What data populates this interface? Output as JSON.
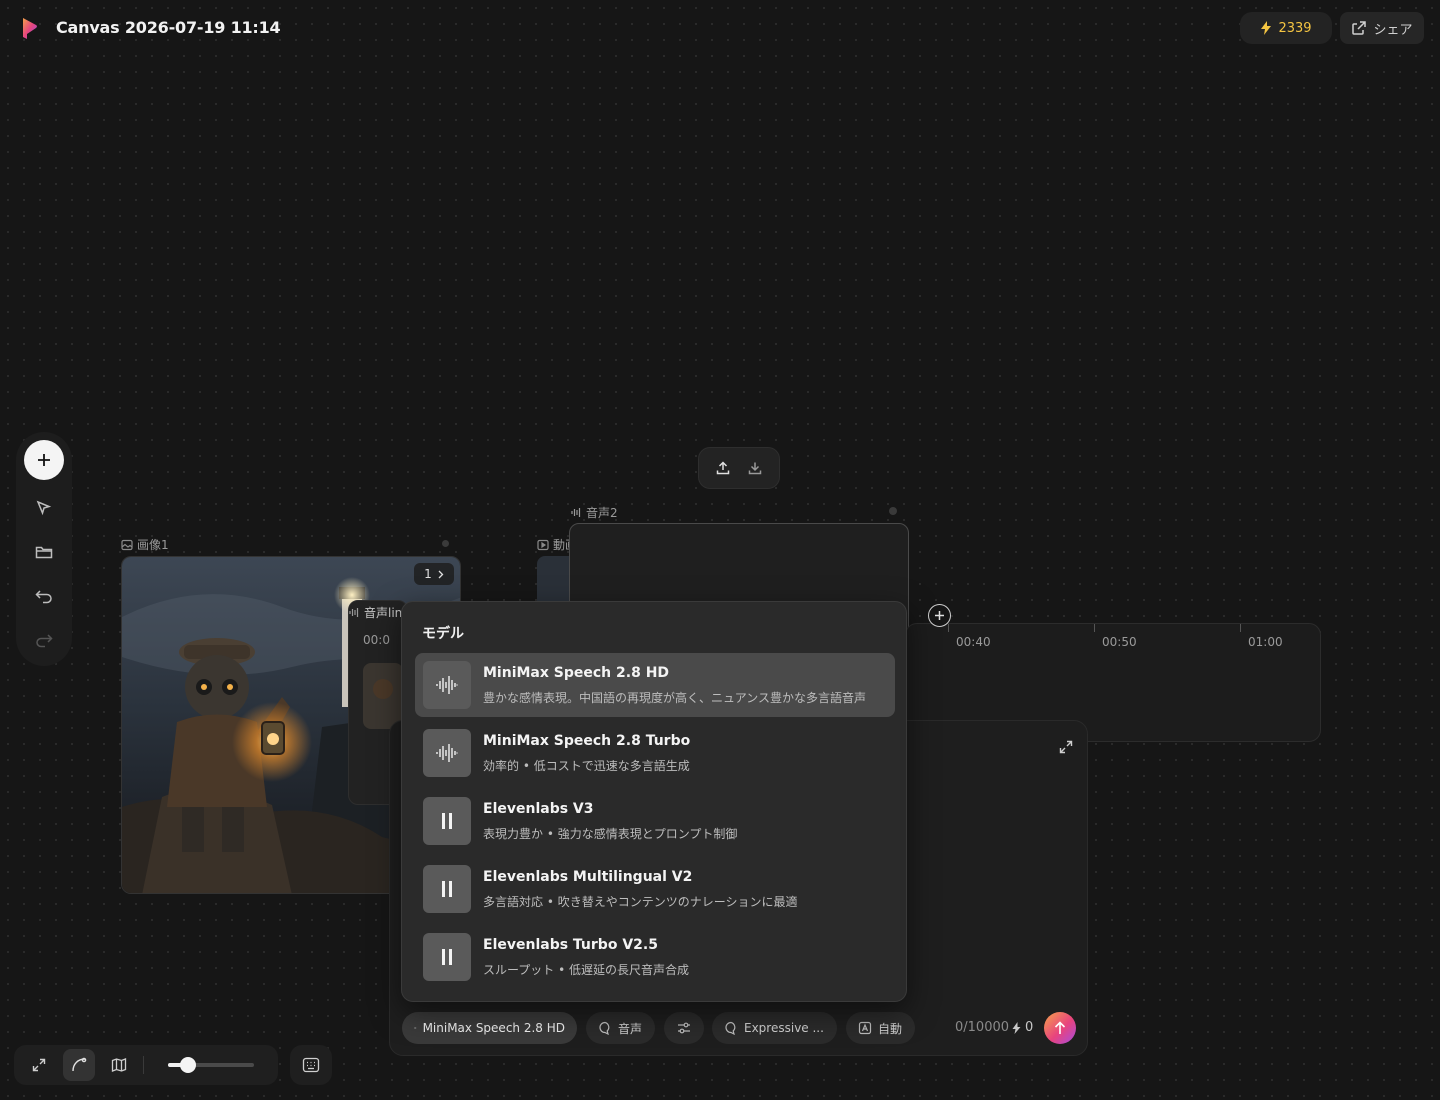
{
  "header": {
    "title": "Canvas 2026-07-19 11:14",
    "credits": "2339",
    "share_label": "シェア"
  },
  "colors": {
    "credit_accent": "#f5c542",
    "send_gradient": [
      "#f5a34a",
      "#e8437e",
      "#a64ce0"
    ]
  },
  "nodes": {
    "image_label": "画像1",
    "image_page": "1",
    "video_label": "動画",
    "audio_label": "音声2",
    "audio_timeline_label": "音声lin",
    "behind_time": "00:0"
  },
  "timeline": {
    "ticks": [
      "00:40",
      "00:50",
      "01:00"
    ]
  },
  "model_dropdown": {
    "header": "モデル",
    "items": [
      {
        "name": "MiniMax Speech 2.8 HD",
        "desc": "豊かな感情表現。中国語の再現度が高く、ニュアンス豊かな多言語音声",
        "icon": "waveform-icon",
        "selected": true
      },
      {
        "name": "MiniMax Speech 2.8 Turbo",
        "desc": "効率的 • 低コストで迅速な多言語生成",
        "icon": "waveform-icon",
        "selected": false
      },
      {
        "name": "Elevenlabs V3",
        "desc": "表現力豊か • 強力な感情表現とプロンプト制御",
        "icon": "elevenlabs-icon",
        "selected": false
      },
      {
        "name": "Elevenlabs Multilingual V2",
        "desc": "多言語対応 • 吹き替えやコンテンツのナレーションに最適",
        "icon": "elevenlabs-icon",
        "selected": false
      },
      {
        "name": "Elevenlabs Turbo V2.5",
        "desc": "スループット • 低遅延の長尺音声合成",
        "icon": "elevenlabs-icon",
        "selected": false
      }
    ]
  },
  "prompt_bar": {
    "model_chip": "MiniMax Speech 2.8 HD",
    "voice_chip": "音声",
    "style_chip": "Expressive ...",
    "auto_chip": "自動",
    "char_count": "0/10000",
    "cost": "0"
  },
  "zoom": {
    "level_fraction": 0.23
  }
}
